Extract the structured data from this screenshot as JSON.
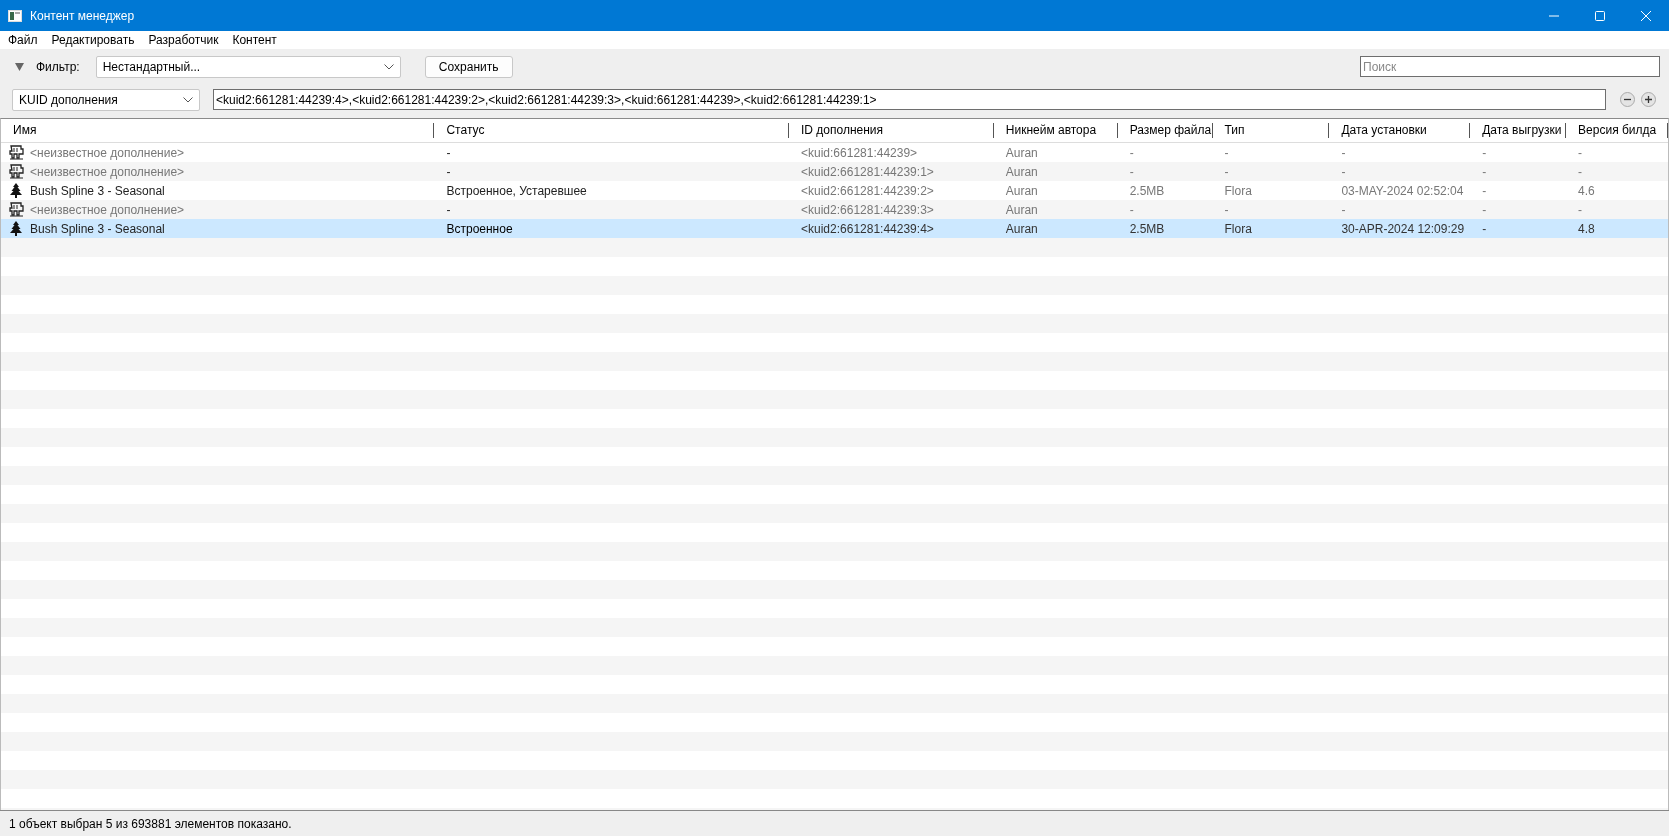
{
  "window": {
    "title": "Контент менеджер"
  },
  "menu": [
    "Файл",
    "Редактировать",
    "Разработчик",
    "Контент"
  ],
  "filter": {
    "label": "Фильтр:",
    "expanded": true,
    "value": "Нестандартный...",
    "save_button": "Сохранить",
    "search_placeholder": "Поиск"
  },
  "query": {
    "field": "KUID дополнения",
    "value": "<kuid2:661281:44239:4>,<kuid2:661281:44239:2>,<kuid2:661281:44239:3>,<kuid:661281:44239>,<kuid2:661281:44239:1>"
  },
  "table": {
    "columns": [
      "Имя",
      "Статус",
      "ID дополнения",
      "Никнейм автора",
      "Размер файла",
      "Тип",
      "Дата установки",
      "Дата выгрузки",
      "Версия билда"
    ],
    "rows": [
      {
        "kind": "unknown",
        "selected": false,
        "cells": [
          "<неизвестное дополнение>",
          "-",
          "<kuid:661281:44239>",
          "Auran",
          "-",
          "-",
          "-",
          "-",
          "-"
        ]
      },
      {
        "kind": "unknown",
        "selected": false,
        "cells": [
          "<неизвестное дополнение>",
          "-",
          "<kuid2:661281:44239:1>",
          "Auran",
          "-",
          "-",
          "-",
          "-",
          "-"
        ]
      },
      {
        "kind": "flora",
        "selected": false,
        "cells": [
          "Bush Spline 3 - Seasonal",
          "Встроенное, Устаревшее",
          "<kuid2:661281:44239:2>",
          "Auran",
          "2.5MB",
          "Flora",
          "03-MAY-2024 02:52:04",
          "-",
          "4.6"
        ]
      },
      {
        "kind": "unknown",
        "selected": false,
        "cells": [
          "<неизвестное дополнение>",
          "-",
          "<kuid2:661281:44239:3>",
          "Auran",
          "-",
          "-",
          "-",
          "-",
          "-"
        ]
      },
      {
        "kind": "flora",
        "selected": true,
        "cells": [
          "Bush Spline 3 - Seasonal",
          "Встроенное",
          "<kuid2:661281:44239:4>",
          "Auran",
          "2.5MB",
          "Flora",
          "30-APR-2024 12:09:29",
          "-",
          "4.8"
        ]
      }
    ]
  },
  "status_bar": "1 объект выбран 5 из 693881 элементов показано."
}
